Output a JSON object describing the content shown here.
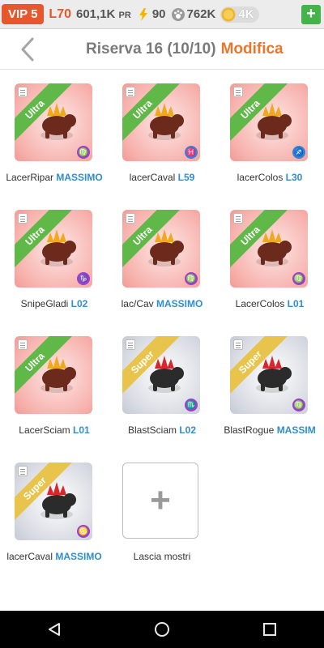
{
  "status_bar": {
    "vip": "VIP 5",
    "level": "L70",
    "pr_value": "601,1K",
    "pr_unit": "PR",
    "energy": "90",
    "food": "762K",
    "gold": "4K",
    "plus": "+"
  },
  "header": {
    "title": "Riserva 16 (10/10)",
    "edit_label": "Modifica"
  },
  "slots": [
    {
      "name": "LacerRipar",
      "tag": "MASSIMO",
      "rank": "Ultra",
      "sign": "♍",
      "sign_color": "#9b3fcf"
    },
    {
      "name": "lacerCaval",
      "tag": "L59",
      "rank": "Ultra",
      "sign": "♓",
      "sign_color": "#3b7fd6"
    },
    {
      "name": "lacerColos",
      "tag": "L30",
      "rank": "Ultra",
      "sign": "♐",
      "sign_color": "#3b7fd6"
    },
    {
      "name": "SnipeGladi",
      "tag": "L02",
      "rank": "Ultra",
      "sign": "♑",
      "sign_color": "#9b3fcf"
    },
    {
      "name": "lac/Cav",
      "tag": "MASSIMO",
      "rank": "Ultra",
      "sign": "♍",
      "sign_color": "#9b3fcf"
    },
    {
      "name": "LacerColos",
      "tag": "L01",
      "rank": "Ultra",
      "sign": "♍",
      "sign_color": "#9b3fcf"
    },
    {
      "name": "LacerSciam",
      "tag": "L01",
      "rank": "Ultra",
      "sign": "",
      "sign_color": ""
    },
    {
      "name": "BlastSciam",
      "tag": "L02",
      "rank": "Super",
      "sign": "♏",
      "sign_color": "#9b3fcf"
    },
    {
      "name": "BlastRogue",
      "tag": "MASSIM",
      "rank": "Super",
      "sign": "♍",
      "sign_color": "#9b3fcf"
    },
    {
      "name": "lacerCaval",
      "tag": "MASSIMO",
      "rank": "Super",
      "sign": "♋",
      "sign_color": "#9b3fcf"
    }
  ],
  "add_slot": {
    "symbol": "+",
    "label": "Lascia mostri"
  },
  "icons": {
    "back": "back-chevron-icon",
    "energy": "lightning-icon",
    "food": "paw-icon",
    "gold": "gold-coin-icon",
    "nav_back": "triangle-back-icon",
    "nav_home": "circle-home-icon",
    "nav_recent": "square-recent-icon"
  },
  "colors": {
    "accent": "#e8562d",
    "edit": "#e8762d",
    "tag_blue": "#2f8ed0",
    "ultra": "#5fb847",
    "super": "#e9c44c"
  }
}
